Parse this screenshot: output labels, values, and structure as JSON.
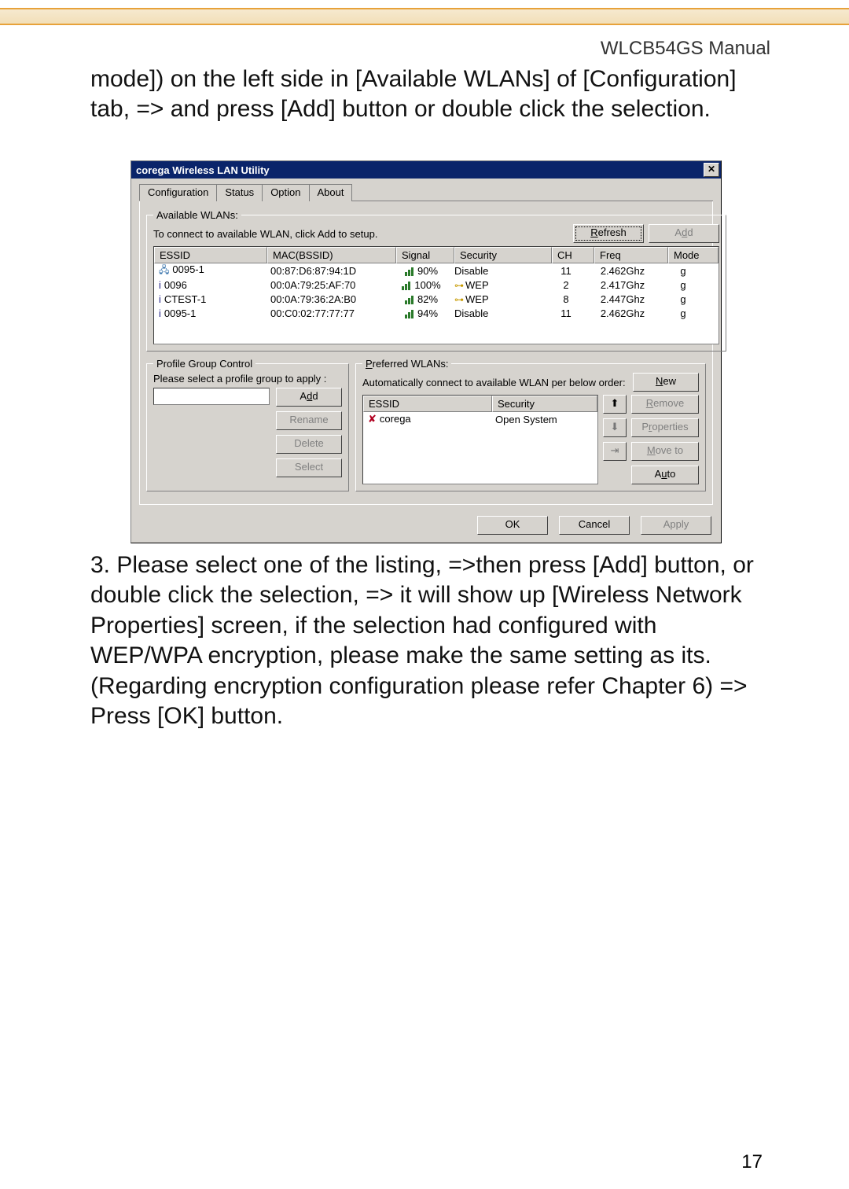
{
  "header": {
    "manual_title": "WLCB54GS Manual"
  },
  "paragraph_top": "mode]) on the left side  in [Available WLANs] of [Configuration] tab, => and press [Add] button or double click the selection.",
  "paragraph_bottom": "3. Please select one of the listing, =>then press [Add] button, or double click the selection, => it will show up [Wireless Network Properties] screen, if the selection had configured with WEP/WPA encryption, please make the same setting as its. (Regarding encryption configuration please refer Chapter 6) => Press [OK] button.",
  "page_number": "17",
  "window": {
    "title": "corega Wireless LAN Utility",
    "close_glyph": "✕",
    "tabs": [
      "Configuration",
      "Status",
      "Option",
      "About"
    ],
    "available_group": {
      "legend": "Available WLANs:",
      "caption": "To connect to available WLAN, click Add to setup.",
      "refresh_btn": "Refresh",
      "add_btn": "Add",
      "columns": {
        "essid": "ESSID",
        "mac": "MAC(BSSID)",
        "signal": "Signal",
        "security": "Security",
        "ch": "CH",
        "freq": "Freq",
        "mode": "Mode"
      },
      "rows": [
        {
          "essid": "0095-1",
          "mac": "00:87:D6:87:94:1D",
          "signal": "90%",
          "key": false,
          "security": "Disable",
          "ch": "11",
          "freq": "2.462Ghz",
          "mode": "g"
        },
        {
          "essid": "0096",
          "mac": "00:0A:79:25:AF:70",
          "signal": "100%",
          "key": true,
          "security": "WEP",
          "ch": "2",
          "freq": "2.417Ghz",
          "mode": "g"
        },
        {
          "essid": "CTEST-1",
          "mac": "00:0A:79:36:2A:B0",
          "signal": "82%",
          "key": true,
          "security": "WEP",
          "ch": "8",
          "freq": "2.447Ghz",
          "mode": "g"
        },
        {
          "essid": "0095-1",
          "mac": "00:C0:02:77:77:77",
          "signal": "94%",
          "key": false,
          "security": "Disable",
          "ch": "11",
          "freq": "2.462Ghz",
          "mode": "g"
        }
      ]
    },
    "profile_group": {
      "legend": "Profile Group Control",
      "caption": "Please select a profile group to apply :",
      "add_btn": "Add",
      "rename_btn": "Rename",
      "delete_btn": "Delete",
      "select_btn": "Select"
    },
    "preferred_group": {
      "legend": "Preferred WLANs:",
      "caption": "Automatically connect to available WLAN per below order:",
      "new_btn": "New",
      "remove_btn": "Remove",
      "properties_btn": "Properties",
      "moveto_btn": "Move to",
      "auto_btn": "Auto",
      "up_glyph": "⬆",
      "down_glyph": "⬇",
      "end_glyph": "⇥",
      "columns": {
        "essid": "ESSID",
        "security": "Security"
      },
      "rows": [
        {
          "essid": "corega",
          "security": "Open System"
        }
      ]
    },
    "dialog_buttons": {
      "ok": "OK",
      "cancel": "Cancel",
      "apply": "Apply"
    }
  }
}
